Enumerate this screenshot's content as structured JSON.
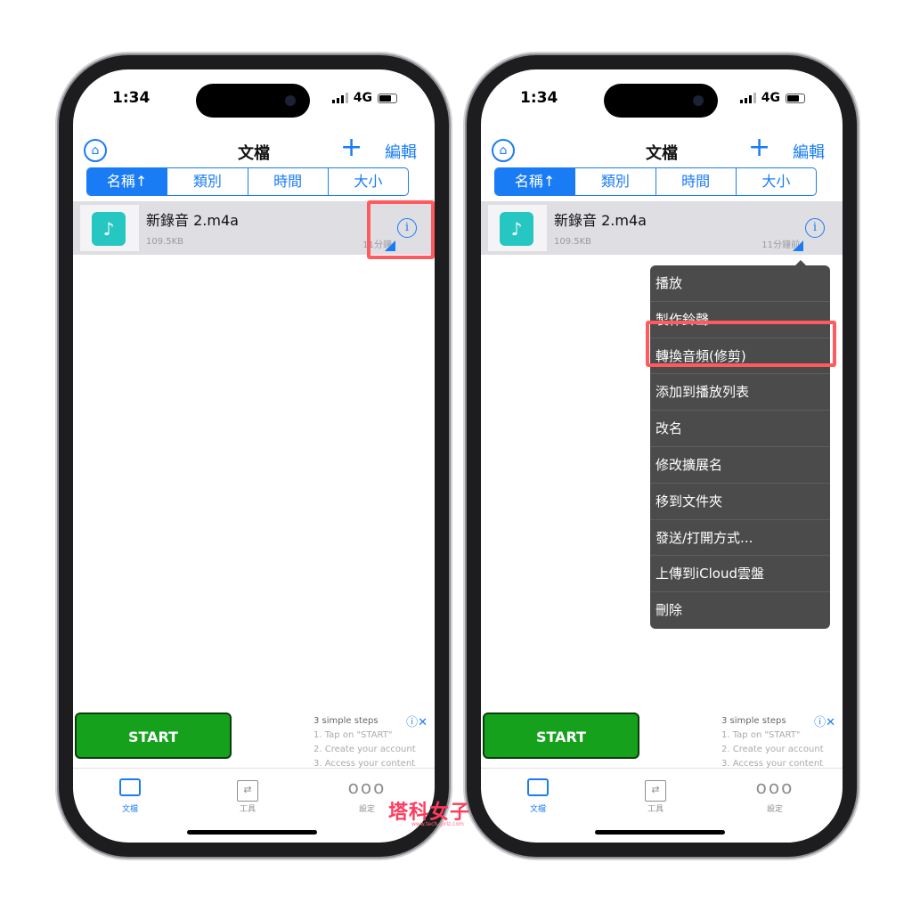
{
  "status": {
    "time": "1:34",
    "network": "4G"
  },
  "nav": {
    "title": "文檔",
    "plus": "+",
    "edit": "編輯"
  },
  "segments": [
    "名稱↑",
    "類別",
    "時間",
    "大小"
  ],
  "file": {
    "name": "新錄音 2.m4a",
    "size": "109.5KB",
    "time_left": "11分鐘",
    "time_right": "11分鐘前"
  },
  "menu": [
    "播放",
    "製作鈴聲",
    "轉換音頻(修剪)",
    "添加到播放列表",
    "改名",
    "修改擴展名",
    "移到文件夾",
    "發送/打開方式...",
    "上傳到iCloud雲盤",
    "刪除"
  ],
  "ad": {
    "start": "START",
    "heading": "3 simple steps",
    "step1": "1. Tap on \"START\"",
    "step2": "2. Create your account",
    "step3": "3. Access your content"
  },
  "tabs": [
    "文檔",
    "工具",
    "設定"
  ],
  "watermark": {
    "main": "塔科女子",
    "url": "www.tech-girlz.com"
  },
  "colors": {
    "accent": "#1a7cf5",
    "highlight": "#ff5a5f",
    "start_button": "#16a11c",
    "menu_bg": "#4b4b4b"
  }
}
